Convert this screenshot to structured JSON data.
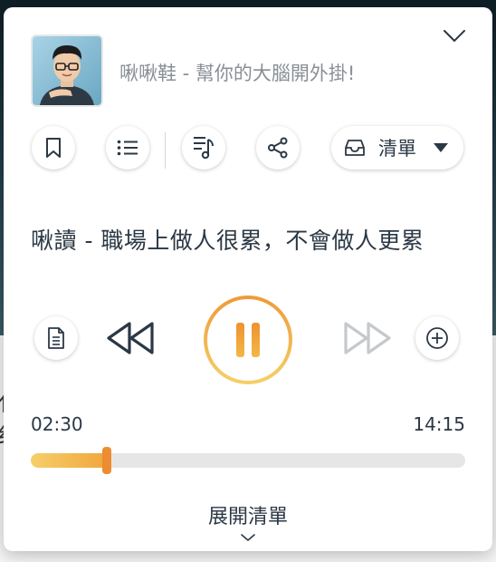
{
  "player": {
    "podcast_title": "啾啾鞋 - 幫你的大腦開外掛!",
    "episode_title": "啾讀 - 職場上做人很累，不會做人更累",
    "list_button_label": "清單",
    "current_time": "02:30",
    "total_time": "14:15",
    "progress_fraction": 0.175,
    "expand_label": "展開清單"
  },
  "background": {
    "glyph_1": "亻",
    "glyph_2": "纟"
  },
  "icons": {
    "collapse": "chevron-down-icon",
    "bookmark": "bookmark-icon",
    "list": "list-icon",
    "playlist": "playlist-music-icon",
    "share": "share-icon",
    "inbox": "inbox-icon",
    "dropdown": "caret-down-icon",
    "document": "document-icon",
    "rewind": "rewind-icon",
    "pause": "pause-icon",
    "forward": "fast-forward-icon",
    "add": "add-circle-icon",
    "expand": "chevron-down-icon"
  },
  "colors": {
    "accent": "#f0a73c",
    "accent_light": "#f6cf6a",
    "handle": "#ee8c32",
    "text_dark": "#2b3845",
    "text_muted": "#8a8f96",
    "disabled": "#c5c9cd"
  }
}
